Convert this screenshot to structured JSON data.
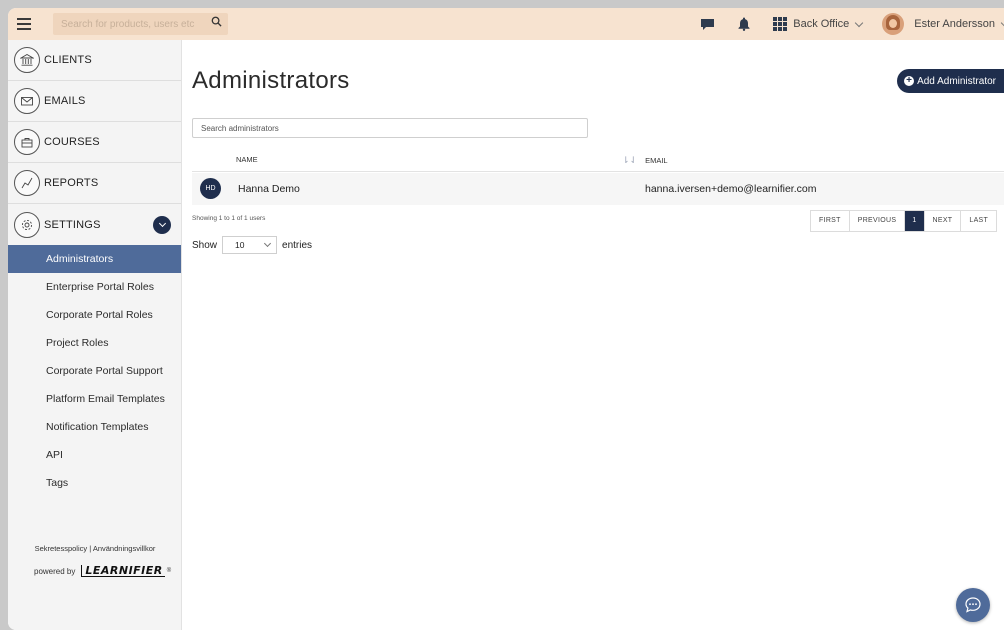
{
  "topbar": {
    "search_placeholder": "Search for products, users etc",
    "app_switcher_label": "Back Office",
    "user_name": "Ester Andersson"
  },
  "sidebar": {
    "main_items": [
      {
        "label": "CLIENTS",
        "icon": "bank-icon"
      },
      {
        "label": "EMAILS",
        "icon": "envelope-icon"
      },
      {
        "label": "COURSES",
        "icon": "briefcase-icon"
      },
      {
        "label": "REPORTS",
        "icon": "chart-line-icon"
      },
      {
        "label": "SETTINGS",
        "icon": "gear-icon"
      }
    ],
    "sub_items": [
      "Administrators",
      "Enterprise Portal Roles",
      "Corporate Portal Roles",
      "Project Roles",
      "Corporate Portal Support",
      "Platform Email Templates",
      "Notification Templates",
      "API",
      "Tags"
    ],
    "active_sub_item": "Administrators",
    "footer_links": "Sekretesspolicy | Användningsvillkor",
    "powered_by": "powered by",
    "logo_text": "LEARNIFIER"
  },
  "main": {
    "title": "Administrators",
    "add_button_label": "Add Administrator",
    "search_placeholder": "Search administrators",
    "columns": [
      "NAME",
      "EMAIL"
    ],
    "rows": [
      {
        "initials": "HD",
        "name": "Hanna Demo",
        "email": "hanna.iversen+demo@learnifier.com"
      }
    ],
    "showing_text": "Showing 1 to 1 of 1 users",
    "show_label": "Show",
    "page_size": "10",
    "entries_label": "entries",
    "pagination": {
      "first": "FIRST",
      "previous": "PREVIOUS",
      "current": "1",
      "next": "NEXT",
      "last": "LAST"
    }
  },
  "colors": {
    "topbar_bg": "#f7e3d0",
    "navy": "#1f2e4d",
    "active_nav": "#4f6b9a"
  }
}
